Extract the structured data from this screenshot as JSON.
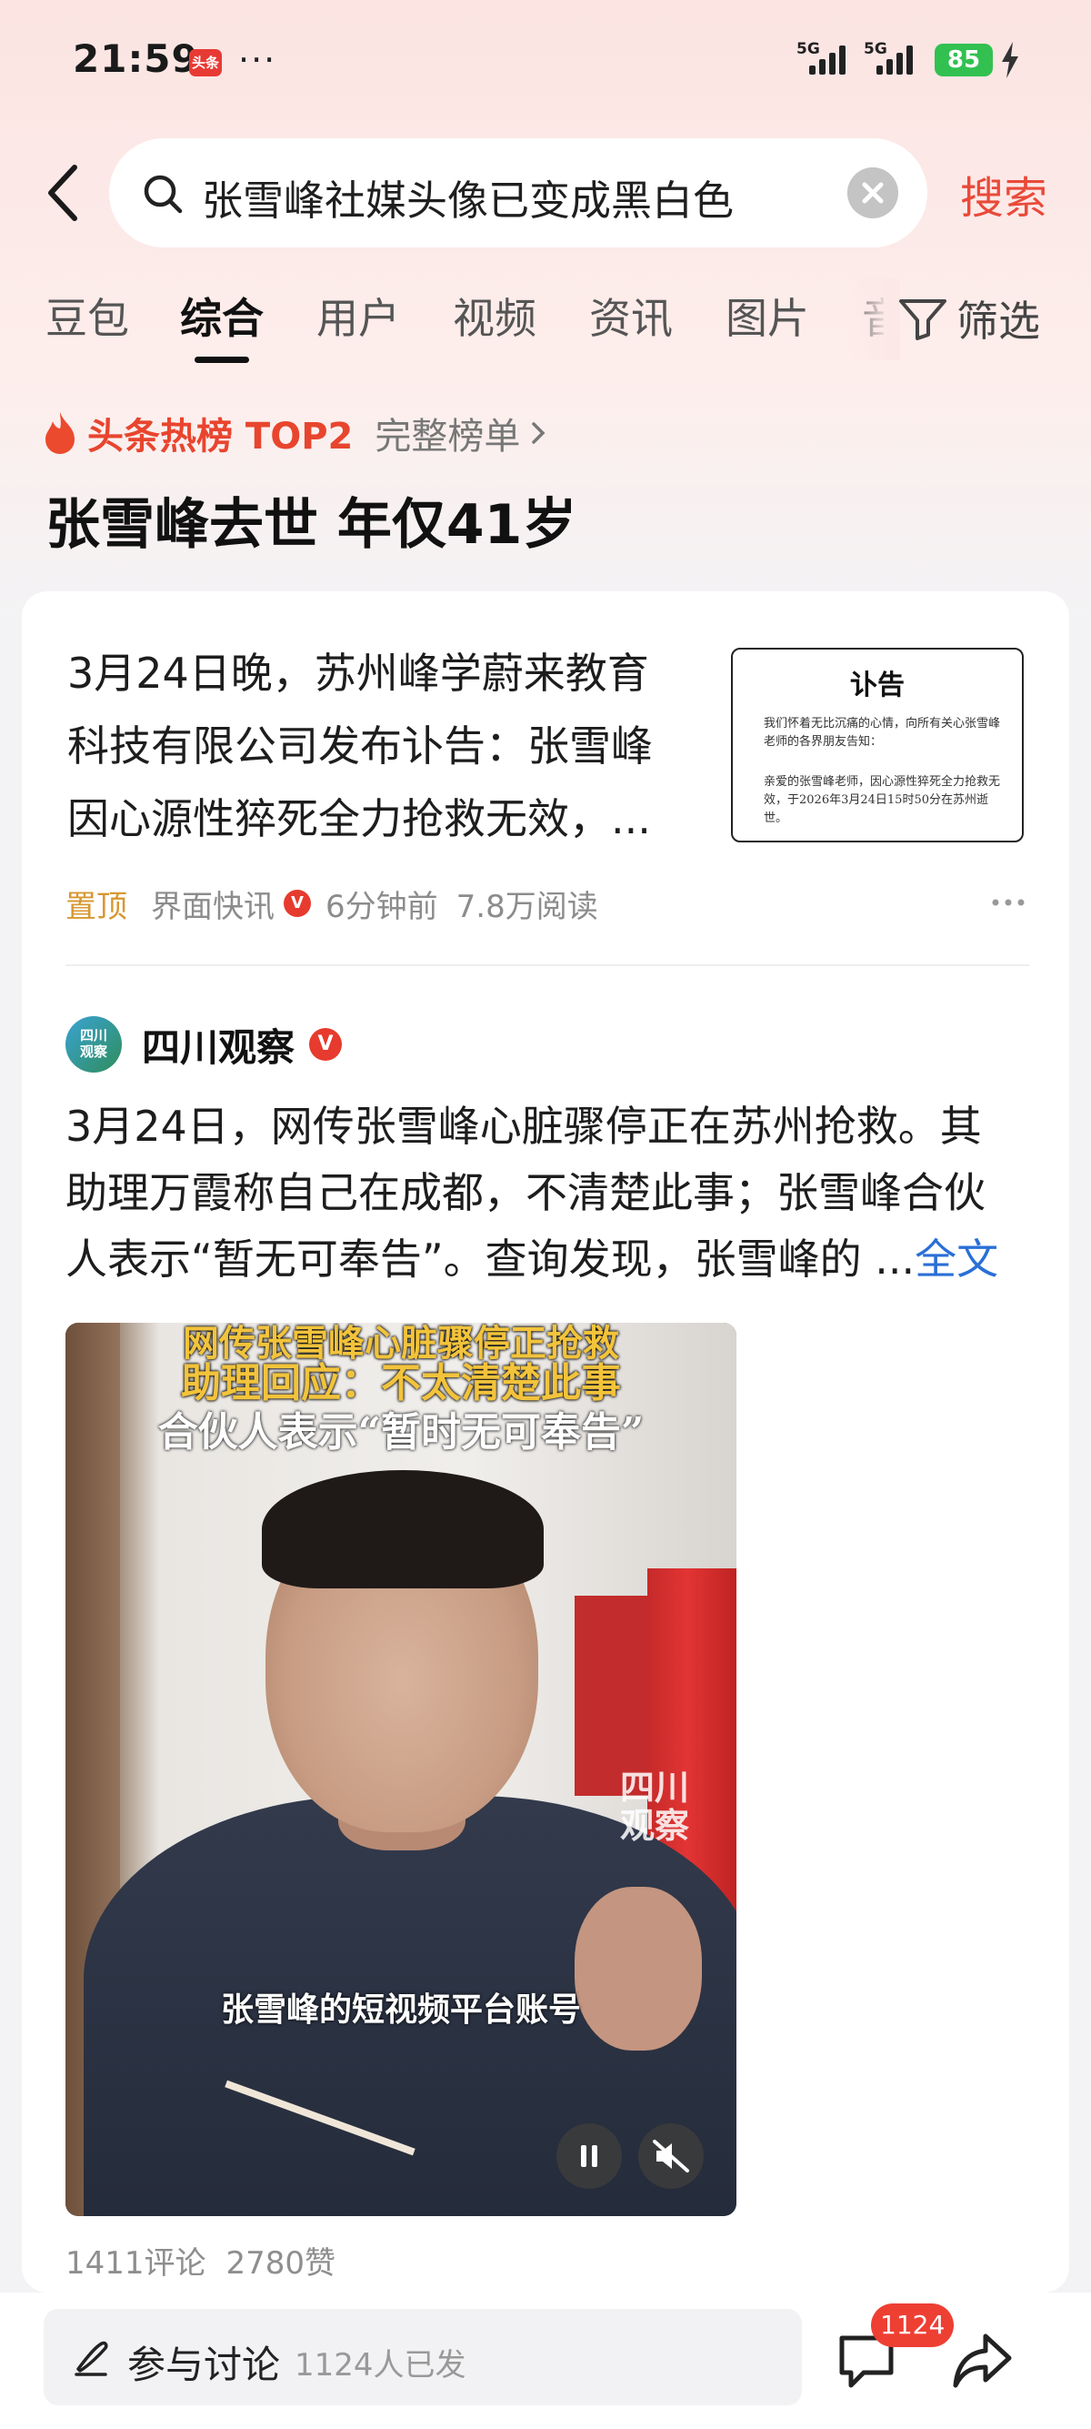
{
  "status_bar": {
    "time": "21:59",
    "app_icon_text": "头条",
    "more": "···",
    "net1": "5G",
    "net2": "5G",
    "battery": "85"
  },
  "search": {
    "query": "张雪峰社媒头像已变成黑白色",
    "button": "搜索"
  },
  "tabs": [
    "豆包",
    "综合",
    "用户",
    "视频",
    "资讯",
    "图片",
    "音"
  ],
  "active_tab": "综合",
  "filter_label": "筛选",
  "hot": {
    "label": "头条热榜 TOP2",
    "more": "完整榜单",
    "title": "张雪峰去世 年仅41岁"
  },
  "article1": {
    "lines": [
      "3月24日晚，苏州峰学蔚来教育",
      "科技有限公司发布讣告：张雪峰",
      "因心源性猝死全力抢救无效，..."
    ],
    "thumbnail": {
      "title": "讣告",
      "para1": "我们怀着无比沉痛的心情，向所有关心张雪峰老师的各界朋友告知：",
      "para2": "亲爱的张雪峰老师，因心源性猝死全力抢救无效，于2026年3月24日15时50分在苏州逝世。"
    },
    "pin": "置顶",
    "source": "界面快讯",
    "verified": "V",
    "time": "6分钟前",
    "reads": "7.8万阅读"
  },
  "article2": {
    "avatar_text": [
      "四川",
      "观察"
    ],
    "author": "四川观察",
    "verified": "V",
    "lines": [
      "3月24日，网传张雪峰心脏骤停正在苏州抢救。其",
      "助理万霞称自己在成都，不清楚此事；张雪峰合伙",
      "人表示“暂无可奉告”。查询发现，张雪峰的 ..."
    ],
    "full_text": "全文",
    "video": {
      "caption1": "网传张雪峰心脏骤停正抢救",
      "caption2": "助理回应：不太清楚此事",
      "caption3": "合伙人表示“暂时无可奉告”",
      "subtitle": "张雪峰的短视频平台账号",
      "watermark": [
        "四川",
        "观察"
      ]
    },
    "comments": "1411评论",
    "likes": "2780赞"
  },
  "bottom": {
    "discuss_label": "参与讨论",
    "discuss_count": "1124人已发",
    "comment_badge": "1124"
  },
  "colors": {
    "accent": "#e94a3a",
    "pin": "#d79832",
    "link": "#2a6fd6",
    "battery": "#32c150"
  }
}
